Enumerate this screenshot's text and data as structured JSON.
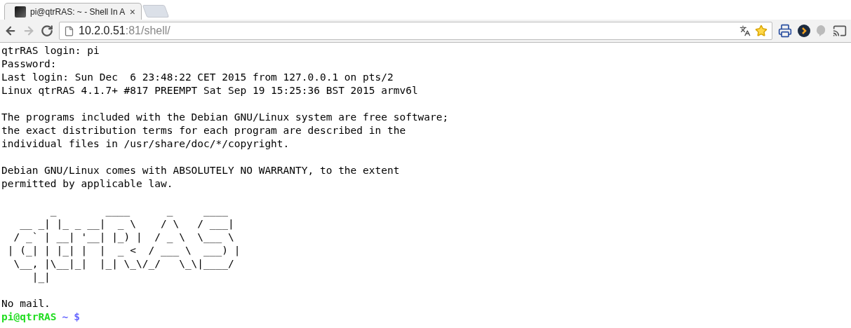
{
  "tabs": [
    {
      "title": "pi@qtrRAS: ~ - Shell In A",
      "close": "×",
      "selected": true
    }
  ],
  "address_bar": {
    "host": "10.2.0.51",
    "rest": ":81/shell/"
  },
  "terminal": {
    "blocks": [
      {
        "kind": "text",
        "lines": [
          "qtrRAS login: pi",
          "Password:",
          "Last login: Sun Dec  6 23:48:22 CET 2015 from 127.0.0.1 on pts/2",
          "Linux qtrRAS 4.1.7+ #817 PREEMPT Sat Sep 19 15:25:36 BST 2015 armv6l"
        ]
      },
      {
        "kind": "text",
        "lines": [
          "The programs included with the Debian GNU/Linux system are free software;",
          "the exact distribution terms for each program are described in the",
          "individual files in /usr/share/doc/*/copyright."
        ]
      },
      {
        "kind": "text",
        "lines": [
          "Debian GNU/Linux comes with ABSOLUTELY NO WARRANTY, to the extent",
          "permitted by applicable law."
        ]
      },
      {
        "kind": "art",
        "text": "        _        ____      _     ____\n   __ _| |_ _ __|  _ \\    / \\   / ___|\n  / _` | __| '__| |_) |  / _ \\  \\___ \\\n | (_| | |_| |  |  _ <  / ___ \\  ___) |\n  \\__, |\\__|_|  |_| \\_\\/_/   \\_\\|____/\n     |_|"
      },
      {
        "kind": "text",
        "lines": [
          "No mail."
        ]
      }
    ],
    "prompt": {
      "user_host": "pi@qtrRAS",
      "path": "~",
      "symbol": "$"
    }
  }
}
